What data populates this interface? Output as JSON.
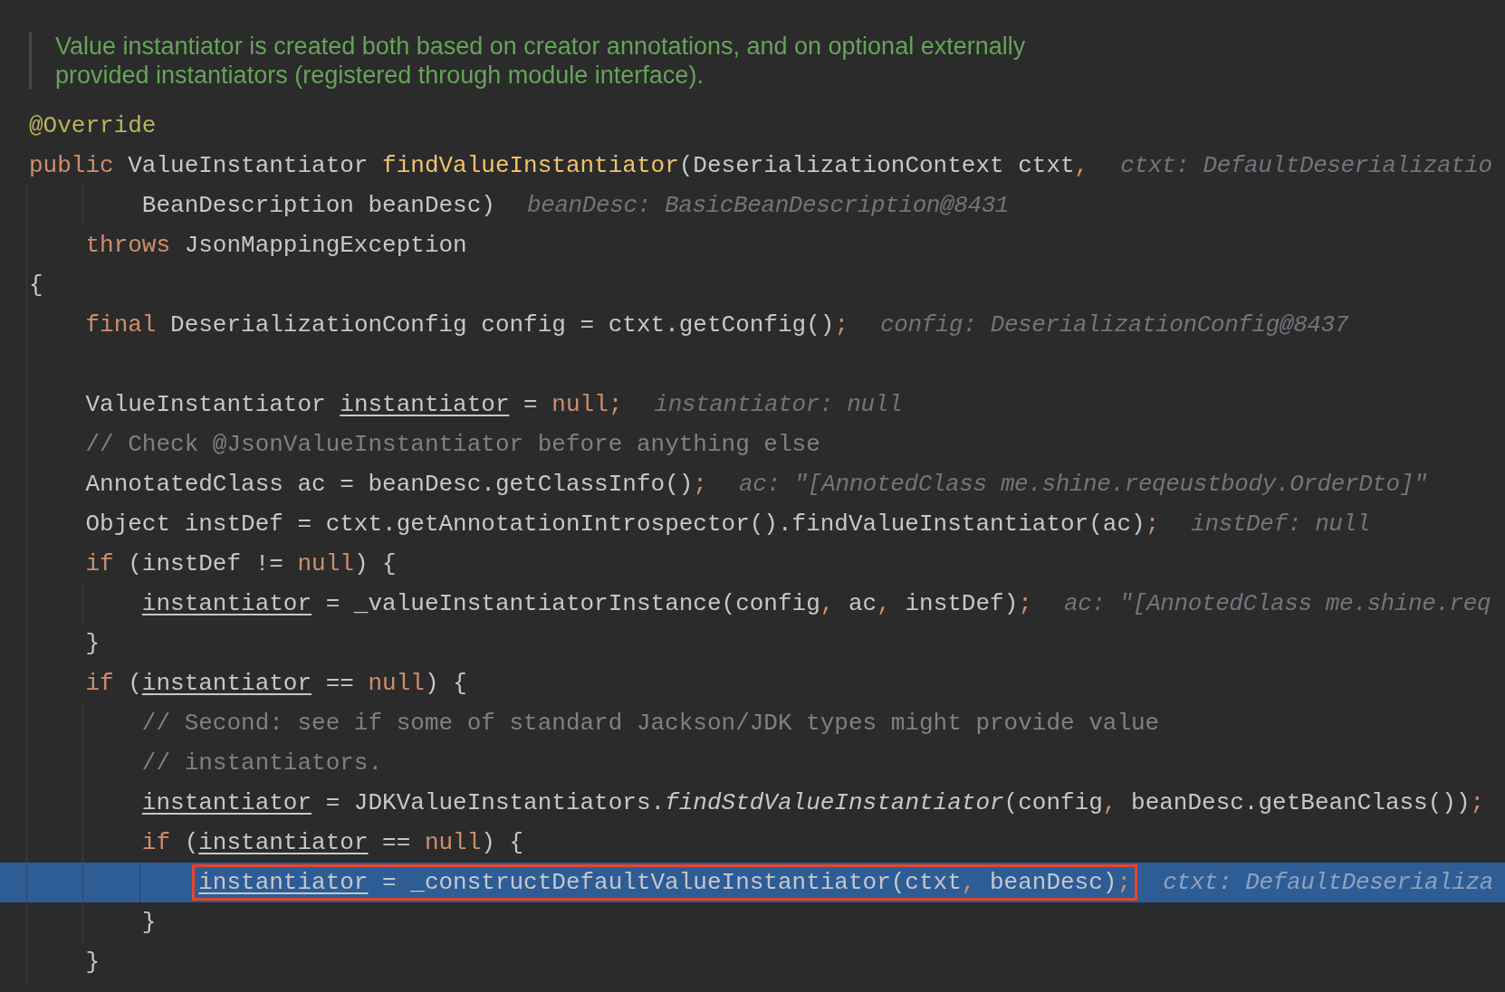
{
  "doc_comment": [
    "Value instantiator is created both based on creator annotations, and on optional externally",
    "provided instantiators (registered through module interface)."
  ],
  "lines": [
    {
      "current": false,
      "tokens": [
        {
          "kind": "annotation",
          "text": "@Override"
        }
      ]
    },
    {
      "current": false,
      "tokens": [
        {
          "kind": "keyword",
          "text": "public "
        },
        {
          "kind": "plain",
          "text": "ValueInstantiator "
        },
        {
          "kind": "declaration",
          "text": "findValueInstantiator"
        },
        {
          "kind": "plain",
          "text": "(DeserializationContext ctxt"
        },
        {
          "kind": "punct",
          "text": ","
        }
      ],
      "hint": "ctxt: DefaultDeserializatio"
    },
    {
      "current": false,
      "tokens": [
        {
          "kind": "plain",
          "text": "        BeanDescription beanDesc)"
        }
      ],
      "hint": "beanDesc: BasicBeanDescription@8431"
    },
    {
      "current": false,
      "tokens": [
        {
          "kind": "keyword",
          "text": "    throws "
        },
        {
          "kind": "plain",
          "text": "JsonMappingException"
        }
      ]
    },
    {
      "current": false,
      "tokens": [
        {
          "kind": "plain",
          "text": "{"
        }
      ]
    },
    {
      "current": false,
      "tokens": [
        {
          "kind": "keyword",
          "text": "    final "
        },
        {
          "kind": "plain",
          "text": "DeserializationConfig config = ctxt.getConfig()"
        },
        {
          "kind": "punct",
          "text": ";"
        }
      ],
      "hint": "config: DeserializationConfig@8437"
    },
    {
      "current": false
    },
    {
      "current": false,
      "tokens": [
        {
          "kind": "plain",
          "text": "    ValueInstantiator "
        },
        {
          "kind": "reassigned",
          "text": "instantiator"
        },
        {
          "kind": "plain",
          "text": " = "
        },
        {
          "kind": "keyword",
          "text": "null"
        },
        {
          "kind": "punct",
          "text": ";"
        }
      ],
      "hint": "instantiator: null"
    },
    {
      "current": false,
      "tokens": [
        {
          "kind": "comment",
          "text": "    // Check @JsonValueInstantiator before anything else"
        }
      ]
    },
    {
      "current": false,
      "tokens": [
        {
          "kind": "plain",
          "text": "    AnnotatedClass ac = beanDesc.getClassInfo()"
        },
        {
          "kind": "punct",
          "text": ";"
        }
      ],
      "hint": "ac: \"[AnnotedClass me.shine.reqeustbody.OrderDto]\""
    },
    {
      "current": false,
      "tokens": [
        {
          "kind": "plain",
          "text": "    Object instDef = ctxt.getAnnotationIntrospector().findValueInstantiator(ac)"
        },
        {
          "kind": "punct",
          "text": ";"
        }
      ],
      "hint": "instDef: null"
    },
    {
      "current": false,
      "tokens": [
        {
          "kind": "keyword",
          "text": "    if "
        },
        {
          "kind": "plain",
          "text": "(instDef != "
        },
        {
          "kind": "keyword",
          "text": "null"
        },
        {
          "kind": "plain",
          "text": ") {"
        }
      ]
    },
    {
      "current": false,
      "tokens": [
        {
          "kind": "reassigned",
          "text": "        instantiator"
        },
        {
          "kind": "plain",
          "text": " = _valueInstantiatorInstance(config"
        },
        {
          "kind": "punct",
          "text": ", "
        },
        {
          "kind": "plain",
          "text": "ac"
        },
        {
          "kind": "punct",
          "text": ", "
        },
        {
          "kind": "plain",
          "text": "instDef)"
        },
        {
          "kind": "punct",
          "text": ";"
        }
      ],
      "hint": "ac: \"[AnnotedClass me.shine.req"
    },
    {
      "current": false,
      "tokens": [
        {
          "kind": "plain",
          "text": "    }"
        }
      ]
    },
    {
      "current": false,
      "tokens": [
        {
          "kind": "keyword",
          "text": "    if "
        },
        {
          "kind": "plain",
          "text": "("
        },
        {
          "kind": "reassigned",
          "text": "instantiator"
        },
        {
          "kind": "plain",
          "text": " == "
        },
        {
          "kind": "keyword",
          "text": "null"
        },
        {
          "kind": "plain",
          "text": ") {"
        }
      ]
    },
    {
      "current": false,
      "tokens": [
        {
          "kind": "comment",
          "text": "        // Second: see if some of standard Jackson/JDK types might provide value"
        }
      ]
    },
    {
      "current": false,
      "tokens": [
        {
          "kind": "comment",
          "text": "        // instantiators."
        }
      ]
    },
    {
      "current": false,
      "tokens": [
        {
          "kind": "reassigned",
          "text": "        instantiator"
        },
        {
          "kind": "plain",
          "text": " = JDKValueInstantiators."
        },
        {
          "kind": "static",
          "text": "findStdValueInstantiator"
        },
        {
          "kind": "plain",
          "text": "(config"
        },
        {
          "kind": "punct",
          "text": ", "
        },
        {
          "kind": "plain",
          "text": "beanDesc.getBeanClass())"
        },
        {
          "kind": "punct",
          "text": ";"
        }
      ]
    },
    {
      "current": false,
      "tokens": [
        {
          "kind": "keyword",
          "text": "        if "
        },
        {
          "kind": "plain",
          "text": "("
        },
        {
          "kind": "reassigned",
          "text": "instantiator"
        },
        {
          "kind": "plain",
          "text": " == "
        },
        {
          "kind": "keyword",
          "text": "null"
        },
        {
          "kind": "plain",
          "text": ") {"
        }
      ]
    },
    {
      "current": true,
      "tokens": [
        {
          "kind": "reassigned",
          "text": "            instantiator"
        },
        {
          "kind": "plain",
          "text": " = _constructDefaultValueInstantiator(ctxt"
        },
        {
          "kind": "punct",
          "text": ", "
        },
        {
          "kind": "plain",
          "text": "beanDesc)"
        },
        {
          "kind": "punct",
          "text": ";"
        }
      ],
      "hint": "ctxt: DefaultDeserializa"
    },
    {
      "current": false,
      "tokens": [
        {
          "kind": "plain",
          "text": "        }"
        }
      ]
    },
    {
      "current": false,
      "tokens": [
        {
          "kind": "plain",
          "text": "    }"
        }
      ]
    }
  ]
}
